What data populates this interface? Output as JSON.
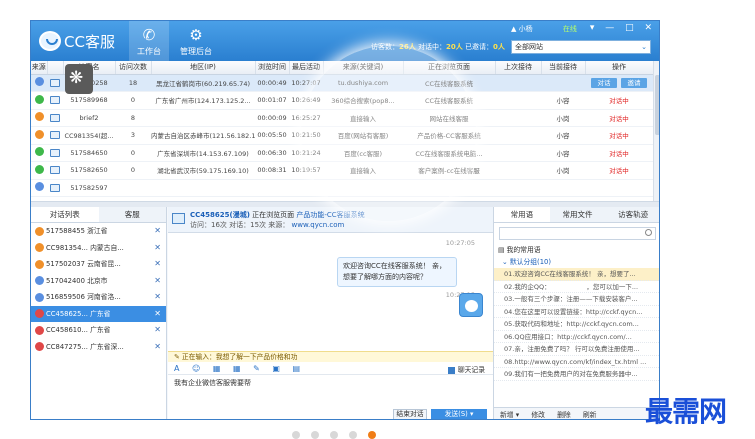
{
  "app": {
    "logo_text": "CC客服",
    "nav": [
      {
        "label": "工作台",
        "icon": "chat-bubble-icon"
      },
      {
        "label": "管理后台",
        "icon": "gear-icon"
      }
    ],
    "user": "小杨",
    "online_status": "在线",
    "status_line": {
      "prefix": "访客数：",
      "visitors": "26人",
      "chatting_label": "对话中：",
      "chatting": "20人",
      "waiting_label": "已邀请：",
      "waiting": "0人"
    },
    "site_select": "全部网站",
    "window_controls": "▾ — □ ✕"
  },
  "visitor_table": {
    "headers": [
      "来源",
      "",
      "访客名",
      "访问次数",
      "地区(IP)",
      "浏览时间",
      "最后活动",
      "来源(关键词)",
      "正在浏览页面",
      "上次接待",
      "当前接待",
      "操作"
    ],
    "rows": [
      {
        "status": "blue",
        "name": "517590258",
        "visits": "18",
        "region": "黑龙江省鹤岗市(60.219.65.74)",
        "duration": "00:00:49",
        "last": "10:27:07",
        "source": "tu.dushiya.com",
        "page": "CC在线客服系统",
        "prev": "",
        "curr": "",
        "op1": "对话",
        "op2": "邀请"
      },
      {
        "status": "green",
        "name": "517589968",
        "visits": "0",
        "region": "广东省广州市(124.173.125.2...",
        "duration": "00:01:07",
        "last": "10:26:49",
        "source": "360综合搜索(pop8...",
        "page": "CC在线客服系统",
        "prev": "",
        "curr": "小容",
        "op1": "对话中",
        "op2": ""
      },
      {
        "status": "orange",
        "name": "brief2",
        "visits": "8",
        "region": "",
        "duration": "00:00:09",
        "last": "16:25:27",
        "source": "直接输入",
        "page": "网站在线客服",
        "prev": "",
        "curr": "小岗",
        "op1": "对话中",
        "op2": ""
      },
      {
        "status": "orange",
        "name": "CC981354(超...",
        "visits": "3",
        "region": "内蒙古自治区赤峰市(121.56.182.11)",
        "duration": "00:05:50",
        "last": "10:21:50",
        "source": "百度(网站有客服)",
        "page": "产品价格-CC客服系统",
        "prev": "",
        "curr": "小容",
        "op1": "对话中",
        "op2": ""
      },
      {
        "status": "green",
        "name": "517584650",
        "visits": "0",
        "region": "广东省深圳市(14.153.67.109)",
        "duration": "00:06:30",
        "last": "10:21:24",
        "source": "百度(cc客服)",
        "page": "CC在线客服系统电脑... ",
        "prev": "",
        "curr": "小容",
        "op1": "对话中",
        "op2": ""
      },
      {
        "status": "green",
        "name": "517582650",
        "visits": "0",
        "region": "湖北省武汉市(59.175.169.10)",
        "duration": "00:08:31",
        "last": "10:19:57",
        "source": "直接输入",
        "page": "客户案例-cc在线客服",
        "prev": "",
        "curr": "小岗",
        "op1": "对话中",
        "op2": ""
      },
      {
        "status": "blue",
        "name": "517582597",
        "visits": "",
        "region": "",
        "duration": "",
        "last": "",
        "source": "",
        "page": "",
        "prev": "",
        "curr": "",
        "op1": "",
        "op2": ""
      }
    ]
  },
  "left_panel": {
    "tabs": [
      "对话列表",
      "客服"
    ],
    "items": [
      {
        "status": "orange",
        "name": "517588455",
        "region": "浙江省"
      },
      {
        "status": "orange",
        "name": "CC981354...",
        "region": "内蒙古自..."
      },
      {
        "status": "orange",
        "name": "517502037",
        "region": "云南省昆..."
      },
      {
        "status": "blue",
        "name": "517042400",
        "region": "北京市"
      },
      {
        "status": "blue",
        "name": "516859506",
        "region": "河南省洛..."
      },
      {
        "status": "red",
        "name": "CC458625...",
        "region": "广东省"
      },
      {
        "status": "red",
        "name": "CC458610...",
        "region": "广东省"
      },
      {
        "status": "red",
        "name": "CC847275...",
        "region": "广东省深..."
      }
    ]
  },
  "chat": {
    "visitor_id": "CC458625(漫城)",
    "browsing_label": "正在浏览页面",
    "browsing_page": "产品功能-CC客服系统",
    "sub": "访问：16次 对话：15次 来源：",
    "sub_link": "www.qycn.com",
    "ts1": "10:27:05",
    "bubble": "欢迎咨询CC在线客服系统！ 亲，想要了解哪方面的内容呢？",
    "ts2": "10:27:15",
    "typing": "正在输入：我想了解一下产品价格和功",
    "toolbar_icons": "A ☺ ▦ ▦ ✎ ▣ ▤",
    "history": "聊天记录",
    "input_text": "我有企业微信客服需要帮",
    "end_btn": "结束对话",
    "send_btn": "发送(S) ▾"
  },
  "right_panel": {
    "tabs": [
      "常用语",
      "常用文件",
      "访客轨迹"
    ],
    "group": "我的常用语",
    "subgroup": "默认分组(10)",
    "items": [
      "01.欢迎咨询CC在线客服系统！ 亲，想要了...",
      "02.我的企QQ：　　　　　　，您可以加一下...",
      "03.一般有三个步骤：注册——下载安装客户...",
      "04.您在这里可以设置链接：http://cckf.qycn...",
      "05.获取代码和地址：http://cckf.qycn.com...",
      "06.QQ应用接口：http://cckf.qycn.com/...",
      "07.亲，注册免费了吗？ 行可以免费注册使用...",
      "08.http://www.qycn.com/kf/index_tx.html ...",
      "09.我们有一把免费用户的对在免费服务器中..."
    ],
    "footer": [
      "新增 ▾",
      "修改",
      "删除",
      "刷新"
    ]
  },
  "watermark": "最需网"
}
